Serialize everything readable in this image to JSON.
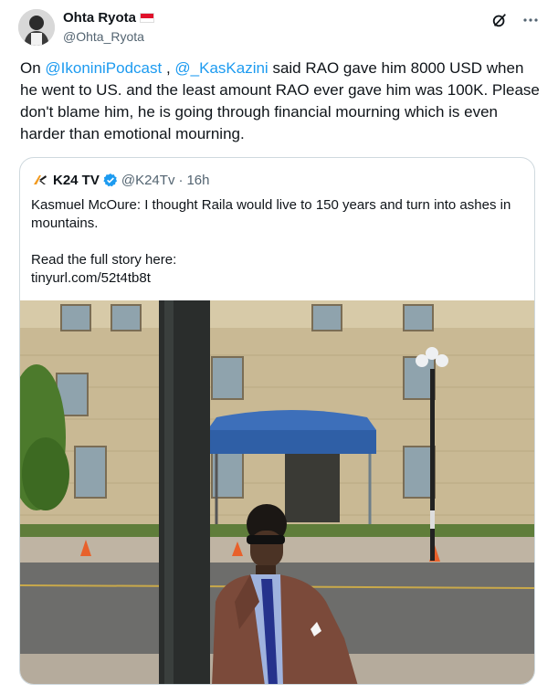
{
  "author": {
    "name": "Ohta Ryota",
    "handle": "@Ohta_Ryota"
  },
  "tweet": {
    "mention1": "@IkoniniPodcast",
    "mention2": "@_KasKazini",
    "text_on": "On ",
    "text_comma": " , ",
    "text_body": "  said RAO gave him 8000 USD when he went to US. and the least amount RAO ever gave him was 100K. Please don't blame him, he is going through financial mourning which is even harder than emotional mourning."
  },
  "quote": {
    "name": "K24 TV",
    "handle": "@K24Tv",
    "separator": "·",
    "time": "16h",
    "line1": "Kasmuel McOure: I thought Raila would live to 150 years and turn into ashes in mountains.",
    "line2": "Read the full story here:",
    "line3": "tinyurl.com/52t4tb8t"
  },
  "colors": {
    "link": "#1d9bf0",
    "verified": "#1d9bf0",
    "secondary_text": "#536471"
  },
  "icons": [
    "grok-icon",
    "more-icon",
    "verified-icon",
    "flag-icon",
    "k24-logo-icon"
  ]
}
